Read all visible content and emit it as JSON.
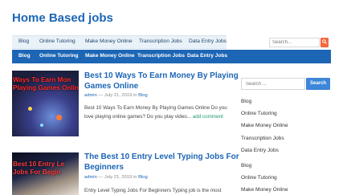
{
  "site": {
    "title": "Home Based jobs"
  },
  "top_nav": [
    "Blog",
    "Online Tutoring",
    "Make Money Online",
    "Transcription Jobs",
    "Data Entry Jobs"
  ],
  "top_search": {
    "placeholder": "Search..."
  },
  "main_nav": [
    "Blog",
    "Online Tutoring",
    "Make Money Online",
    "Transcription Jobs",
    "Data Entry Jobs"
  ],
  "posts": [
    {
      "title_line1": "Best 10 Ways To Earn Money By Playing",
      "title_line2": "Games Online",
      "author": "admin",
      "date": "— July 21, 2019 in",
      "category": "Blog",
      "excerpt_line1": "Best 10 Ways To Earn Money By Playing Games Online Do you",
      "excerpt_line2": "love playing online games? Do you play video...",
      "more": "add comment",
      "thumb_line1": "Ways To Earn Mon",
      "thumb_line2": "Playing Games Online"
    },
    {
      "title_line1": "The Best 10 Entry Level Typing Jobs For",
      "title_line2": "Beginners",
      "author": "admin",
      "date": "— July 21, 2019 in",
      "category": "Blog",
      "excerpt_line1": "Entry Level Typing Jobs For Beginners Typing job is the most",
      "thumb_line1": "Best 10 Entry Le",
      "thumb_line2": "Jobs For Begin"
    }
  ],
  "sidebar": {
    "search_placeholder": "Search ...",
    "search_button": "Search",
    "links": [
      "Blog",
      "Online Tutoring",
      "Make Money Online",
      "Transcription Jobs",
      "Data Entry Jobs",
      "Blog",
      "Online Tutoring",
      "Make Money Online"
    ]
  },
  "colors": {
    "brand": "#1c66b5",
    "accent": "#f4673f",
    "button": "#3d86d9"
  }
}
